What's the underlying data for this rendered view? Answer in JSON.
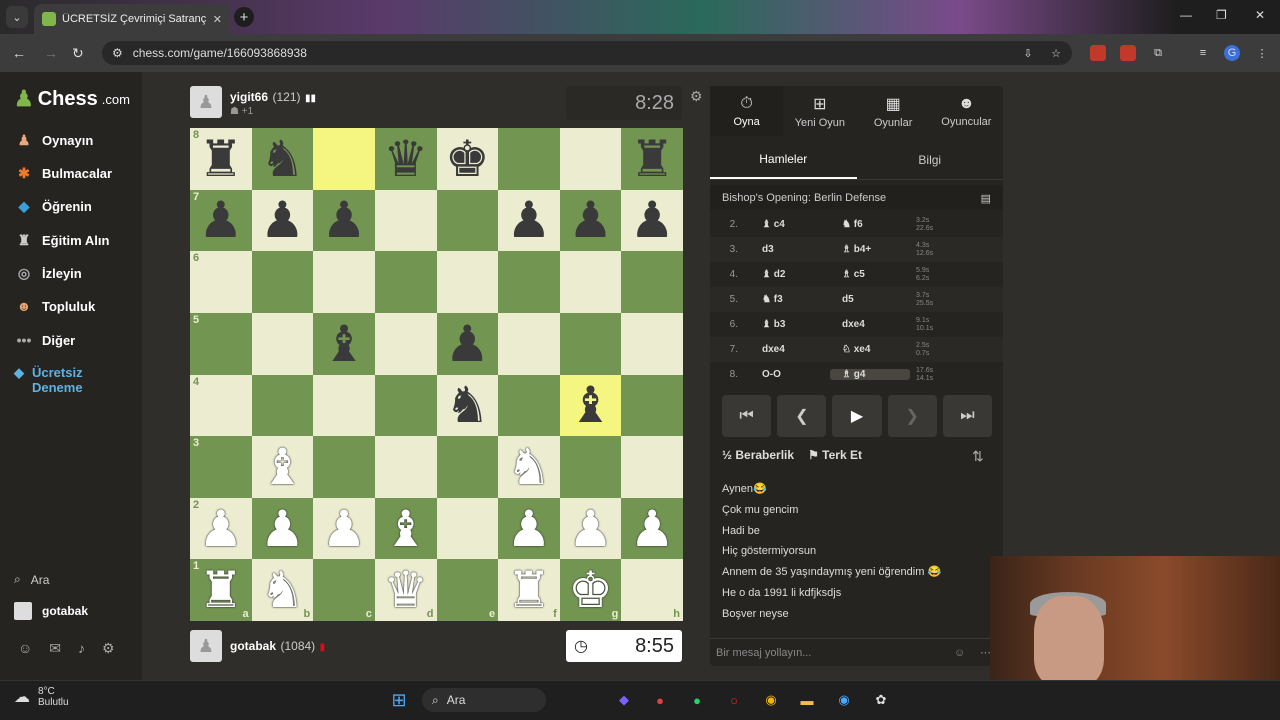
{
  "browser": {
    "tab_title": "ÜCRETSİZ Çevrimiçi Satranç Oyna",
    "url": "chess.com/game/166093868938",
    "close": "✕",
    "newtab": "+"
  },
  "sidebar": {
    "logo": "Chess",
    "logo_suffix": ".com",
    "items": [
      {
        "label": "Oynayın",
        "icon": "play-icon"
      },
      {
        "label": "Bulmacalar",
        "icon": "puzzle-icon"
      },
      {
        "label": "Öğrenin",
        "icon": "learn-icon"
      },
      {
        "label": "Eğitim Alın",
        "icon": "coach-icon"
      },
      {
        "label": "İzleyin",
        "icon": "watch-icon"
      },
      {
        "label": "Topluluk",
        "icon": "community-icon"
      },
      {
        "label": "Diğer",
        "icon": "more-icon"
      }
    ],
    "trial": "Ücretsiz Deneme",
    "search": "Ara",
    "user": "gotabak"
  },
  "top_player": {
    "name": "yigit66",
    "rating": "(121)",
    "extra": "+1",
    "clock": "8:28"
  },
  "bottom_player": {
    "name": "gotabak",
    "rating": "(1084)",
    "clock": "8:55"
  },
  "board": {
    "ranks": [
      "8",
      "7",
      "6",
      "5",
      "4",
      "3",
      "2",
      "1"
    ],
    "files": [
      "a",
      "b",
      "c",
      "d",
      "e",
      "f",
      "g",
      "h"
    ],
    "rows": [
      [
        "r",
        "n",
        "",
        "q",
        "k",
        "",
        "",
        "r"
      ],
      [
        "p",
        "p",
        "p",
        "",
        "",
        "p",
        "p",
        "p"
      ],
      [
        "",
        "",
        "",
        "",
        "",
        "",
        "",
        ""
      ],
      [
        "",
        "",
        "b",
        "",
        "p",
        "",
        "",
        ""
      ],
      [
        "",
        "",
        "",
        "",
        "n",
        "",
        "b",
        ""
      ],
      [
        "",
        "B",
        "",
        "",
        "",
        "N",
        "",
        ""
      ],
      [
        "P",
        "P",
        "P",
        "B",
        "",
        "P",
        "P",
        "P"
      ],
      [
        "R",
        "N",
        "",
        "Q",
        "",
        "R",
        "K",
        ""
      ]
    ]
  },
  "right": {
    "tabs": [
      "Oyna",
      "Yeni Oyun",
      "Oyunlar",
      "Oyuncular"
    ],
    "subtabs": [
      "Hamleler",
      "Bilgi"
    ],
    "opening": "Bishop's Opening: Berlin Defense",
    "moves": [
      {
        "n": "2.",
        "w": "♝ c4",
        "b": "♞ f6",
        "t1": "3.2s",
        "t2": "22.6s"
      },
      {
        "n": "3.",
        "w": "d3",
        "b": "♗ b4+",
        "t1": "4.3s",
        "t2": "12.6s"
      },
      {
        "n": "4.",
        "w": "♝ d2",
        "b": "♗ c5",
        "t1": "5.9s",
        "t2": "6.2s"
      },
      {
        "n": "5.",
        "w": "♞ f3",
        "b": "d5",
        "t1": "3.7s",
        "t2": "25.5s"
      },
      {
        "n": "6.",
        "w": "♝ b3",
        "b": "dxe4",
        "t1": "9.1s",
        "t2": "10.1s"
      },
      {
        "n": "7.",
        "w": "dxe4",
        "b": "♘ xe4",
        "t1": "2.5s",
        "t2": "0.7s"
      },
      {
        "n": "8.",
        "w": "O-O",
        "b": "♗ g4",
        "t1": "17.6s",
        "t2": "14.1s"
      }
    ],
    "draw": "Beraberlik",
    "resign": "Terk Et",
    "chat": [
      "Aynen😂",
      "Çok mu gencim",
      "Hadi be",
      "Hiç göstermiyorsun",
      "Annem de 35 yaşındaymış yeni öğrendim 😂",
      "He o da 1991 li kdfjksdjs",
      "Boşver neyse"
    ],
    "chat_placeholder": "Bir mesaj yollayın..."
  },
  "taskbar": {
    "temp": "8°C",
    "weather": "Bulutlu",
    "search": "Ara"
  }
}
